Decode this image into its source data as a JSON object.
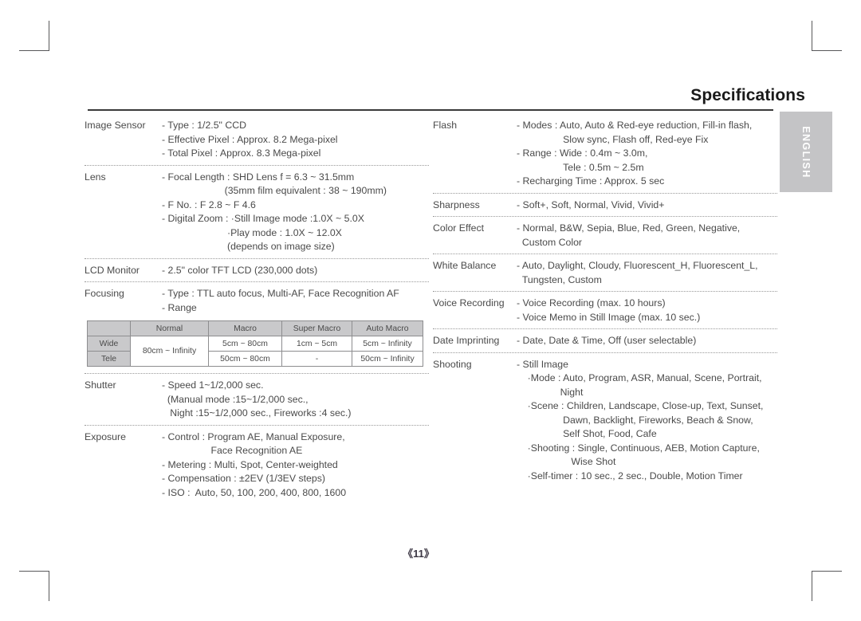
{
  "page": {
    "title": "Specifications",
    "language_tab": "ENGLISH",
    "page_number": "《11》"
  },
  "colors": {
    "text": "#4a4a4a",
    "title": "#1a1a1a",
    "rule": "#3a3a3a",
    "tab_bg": "#c4c4c6",
    "tab_text": "#ffffff",
    "table_header_bg": "#c9c9cb",
    "table_border": "#8d8d8f",
    "crop_mark": "#58585a"
  },
  "left_column": [
    {
      "label": "Image Sensor",
      "value": "- Type : 1/2.5\" CCD\n- Effective Pixel : Approx. 8.2 Mega-pixel\n- Total Pixel : Approx. 8.3 Mega-pixel"
    },
    {
      "label": "Lens",
      "value": "- Focal Length : SHD Lens f = 6.3 ~ 31.5mm\n                       (35mm film equivalent : 38 ~ 190mm)\n- F No. : F 2.8 ~ F 4.6\n- Digital Zoom : ·Still Image mode :1.0X ~ 5.0X\n                        ·Play mode : 1.0X ~ 12.0X\n                        (depends on image size)"
    },
    {
      "label": "LCD Monitor",
      "value": "- 2.5\" color TFT LCD (230,000 dots)"
    },
    {
      "label": "Focusing",
      "value": "- Type : TTL auto focus, Multi-AF, Face Recognition AF\n- Range"
    },
    {
      "label": "Shutter",
      "value": "- Speed 1~1/2,000 sec.\n  (Manual mode :15~1/2,000 sec.,\n   Night :15~1/2,000 sec., Fireworks :4 sec.)"
    },
    {
      "label": "Exposure",
      "value": "- Control : Program AE, Manual Exposure,\n                  Face Recognition AE\n- Metering : Multi, Spot, Center-weighted\n- Compensation : ±2EV (1/3EV steps)\n- ISO :  Auto, 50, 100, 200, 400, 800, 1600"
    }
  ],
  "focus_table": {
    "columns": [
      "",
      "Normal",
      "Macro",
      "Super Macro",
      "Auto Macro"
    ],
    "rows": [
      {
        "head": "Wide",
        "cells": [
          "80cm ~ Infinity",
          "5cm ~ 80cm",
          "1cm ~ 5cm",
          "5cm ~ Infinity"
        ]
      },
      {
        "head": "Tele",
        "cells": [
          "50cm ~  80cm",
          "-",
          "50cm ~ Infinity"
        ]
      }
    ]
  },
  "right_column": [
    {
      "label": "Flash",
      "value": "- Modes : Auto, Auto & Red-eye reduction, Fill-in flash,\n                 Slow sync, Flash off, Red-eye Fix\n- Range : Wide : 0.4m ~ 3.0m,\n                 Tele : 0.5m ~ 2.5m\n- Recharging Time : Approx. 5 sec"
    },
    {
      "label": "Sharpness",
      "value": "- Soft+, Soft, Normal, Vivid, Vivid+"
    },
    {
      "label": "Color Effect",
      "value": "- Normal, B&W, Sepia, Blue, Red, Green, Negative,\n  Custom Color"
    },
    {
      "label": "White Balance",
      "value": "- Auto, Daylight, Cloudy, Fluorescent_H, Fluorescent_L,\n  Tungsten, Custom"
    },
    {
      "label": "Voice Recording",
      "value": "- Voice Recording (max. 10 hours)\n- Voice Memo in Still Image (max. 10 sec.)"
    },
    {
      "label": "Date Imprinting",
      "value": "- Date, Date & Time, Off (user selectable)"
    },
    {
      "label": "Shooting",
      "value": "- Still Image\n    ·Mode : Auto, Program, ASR, Manual, Scene, Portrait,\n                Night\n    ·Scene : Children, Landscape, Close-up, Text, Sunset,\n                 Dawn, Backlight, Fireworks, Beach & Snow,\n                 Self Shot, Food, Cafe\n    ·Shooting : Single, Continuous, AEB, Motion Capture,\n                    Wise Shot\n    ·Self-timer : 10 sec., 2 sec., Double, Motion Timer"
    }
  ]
}
